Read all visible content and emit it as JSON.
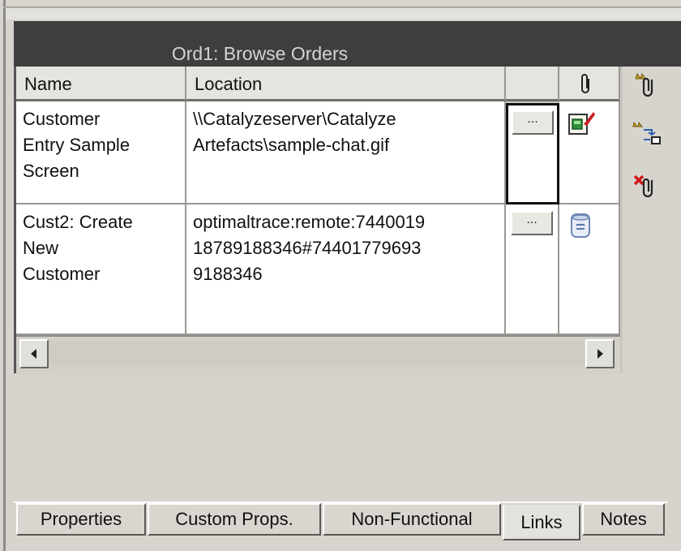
{
  "panel": {
    "title": "Ord1: Browse Orders"
  },
  "table": {
    "columns": [
      "Name",
      "Location",
      "",
      ""
    ],
    "rows": [
      {
        "name": "Customer\nEntry Sample\nScreen",
        "location": "\\\\Catalyzeserver\\Catalyze\nArtefacts\\sample-chat.gif",
        "button_label": "...",
        "type_icon": "image-file-icon"
      },
      {
        "name": "Cust2: Create\nNew\nCustomer",
        "location": "optimaltrace:remote:7440019\n18789188346#74401779693\n9188346",
        "button_label": "...",
        "type_icon": "linked-element-icon"
      }
    ],
    "attachment_header_icon": "paperclip-icon"
  },
  "toolbar_icons": [
    "add-link-icon",
    "link-to-element-icon",
    "remove-link-icon"
  ],
  "tabs": [
    {
      "label": "Properties",
      "active": false
    },
    {
      "label": "Custom Props.",
      "active": false
    },
    {
      "label": "Non-Functional",
      "active": false
    },
    {
      "label": "Links",
      "active": true
    },
    {
      "label": "Notes",
      "active": false
    }
  ],
  "colors": {
    "title_bar": "#3e3e3e",
    "title_text": "#d4d4d4",
    "panel_bg": "#d7d4ce"
  }
}
